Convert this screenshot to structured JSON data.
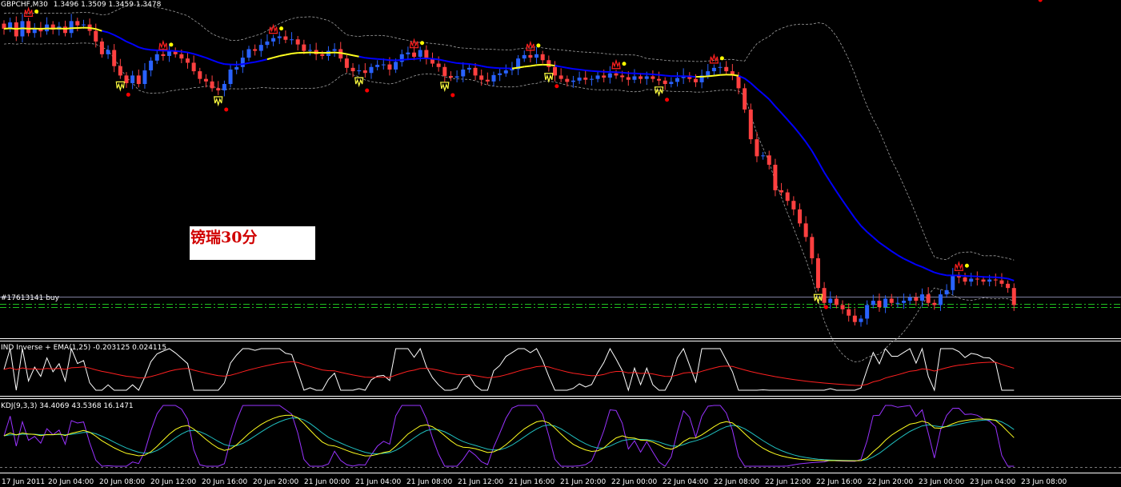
{
  "main": {
    "symbol_label": "GBPCHF,M30",
    "ohlc_label": "1.3496 1.3509 1.3459 1.3478",
    "annotation": "镑瑞30分",
    "order_label": "#17613141 buy"
  },
  "indicator1": {
    "label": "IND Inverse + EMA(1,25) -0.203125 0.024115"
  },
  "indicator2": {
    "label": "KDJ(9,3,3) 34.4069 43.5368 16.1471"
  },
  "time_axis": {
    "labels": [
      "17 Jun 2011",
      "20 Jun 04:00",
      "20 Jun 08:00",
      "20 Jun 12:00",
      "20 Jun 16:00",
      "20 Jun 20:00",
      "21 Jun 00:00",
      "21 Jun 04:00",
      "21 Jun 08:00",
      "21 Jun 12:00",
      "21 Jun 16:00",
      "21 Jun 20:00",
      "22 Jun 00:00",
      "22 Jun 04:00",
      "22 Jun 08:00",
      "22 Jun 12:00",
      "22 Jun 16:00",
      "22 Jun 20:00",
      "23 Jun 00:00",
      "23 Jun 04:00",
      "23 Jun 08:00"
    ]
  },
  "colors": {
    "bull": "#2962ff",
    "bear": "#ff4040",
    "ma_blue": "#0000ff",
    "ma_yellow": "#ffff20",
    "band": "#a0a0a0",
    "dot_red": "#ff0000",
    "dot_yellow": "#ffff00",
    "hand_red": "#ff2020",
    "hand_yellow": "#ffff40",
    "ind_white": "#ffffff",
    "ind_red": "#ff2020",
    "kdj_k": "#ffffff",
    "kdj_d": "#ffff20",
    "kdj_j": "#9933ff",
    "kdj_cyan": "#20c0c0",
    "order_line": "#20c020",
    "separator": "#ffffff"
  },
  "chart_data": {
    "type": "candlestick",
    "title": "GBPCHF,M30",
    "ohlc_last": {
      "open": 1.3496,
      "high": 1.3509,
      "low": 1.3459,
      "close": 1.3478
    },
    "closes": [
      1.353,
      1.3545,
      1.3512,
      1.3548,
      1.352,
      1.3532,
      1.3524,
      1.354,
      1.3528,
      1.3535,
      1.352,
      1.3548,
      1.3538,
      1.354,
      1.3525,
      1.35,
      1.347,
      1.348,
      1.3442,
      1.342,
      1.3402,
      1.342,
      1.34,
      1.3432,
      1.3455,
      1.347,
      1.3466,
      1.3478,
      1.347,
      1.346,
      1.345,
      1.343,
      1.3412,
      1.3406,
      1.339,
      1.3385,
      1.34,
      1.3434,
      1.344,
      1.3462,
      1.3482,
      1.3478,
      1.3492,
      1.35,
      1.3508,
      1.3512,
      1.3504,
      1.3505,
      1.3493,
      1.3478,
      1.348,
      1.347,
      1.3466,
      1.3478,
      1.3482,
      1.346,
      1.3438,
      1.343,
      1.3432,
      1.3426,
      1.344,
      1.3445,
      1.3446,
      1.3434,
      1.3452,
      1.347,
      1.3474,
      1.3464,
      1.348,
      1.346,
      1.3448,
      1.344,
      1.3419,
      1.3415,
      1.3418,
      1.3434,
      1.3438,
      1.342,
      1.341,
      1.3406,
      1.3421,
      1.3425,
      1.3432,
      1.3435,
      1.346,
      1.3468,
      1.3462,
      1.347,
      1.3456,
      1.344,
      1.342,
      1.3412,
      1.3405,
      1.3408,
      1.3415,
      1.341,
      1.3412,
      1.342,
      1.3415,
      1.3425,
      1.342,
      1.3416,
      1.341,
      1.3418,
      1.3412,
      1.3418,
      1.3412,
      1.3408,
      1.34,
      1.3405,
      1.3414,
      1.342,
      1.3412,
      1.3404,
      1.342,
      1.343,
      1.3438,
      1.344,
      1.343,
      1.342,
      1.339,
      1.334,
      1.327,
      1.323,
      1.3232,
      1.321,
      1.315,
      1.3145,
      1.3125,
      1.3105,
      1.3072,
      1.304,
      1.299,
      1.292,
      1.2885,
      1.2895,
      1.288,
      1.287,
      1.2855,
      1.284,
      1.2848,
      1.288,
      1.289,
      1.2875,
      1.2895,
      1.2885,
      1.2885,
      1.289,
      1.2898,
      1.289,
      1.2905,
      1.2885,
      1.288,
      1.2905,
      1.2915,
      1.295,
      1.2945,
      1.2935,
      1.2942,
      1.294,
      1.2935,
      1.294,
      1.2938,
      1.293,
      1.292,
      1.288
    ],
    "last_marked_price": 1.288,
    "order": {
      "label": "#17613141 buy"
    },
    "time_labels": [
      "17 Jun 2011",
      "20 Jun 04:00",
      "20 Jun 08:00",
      "20 Jun 12:00",
      "20 Jun 16:00",
      "20 Jun 20:00",
      "21 Jun 00:00",
      "21 Jun 04:00",
      "21 Jun 08:00",
      "21 Jun 12:00",
      "21 Jun 16:00",
      "21 Jun 20:00",
      "22 Jun 00:00",
      "22 Jun 04:00",
      "22 Jun 08:00",
      "22 Jun 12:00",
      "22 Jun 16:00",
      "22 Jun 20:00",
      "23 Jun 00:00",
      "23 Jun 04:00",
      "23 Jun 08:00"
    ],
    "panels": [
      "price",
      "IND Inverse + EMA(1,25)",
      "KDJ(9,3,3)"
    ]
  }
}
